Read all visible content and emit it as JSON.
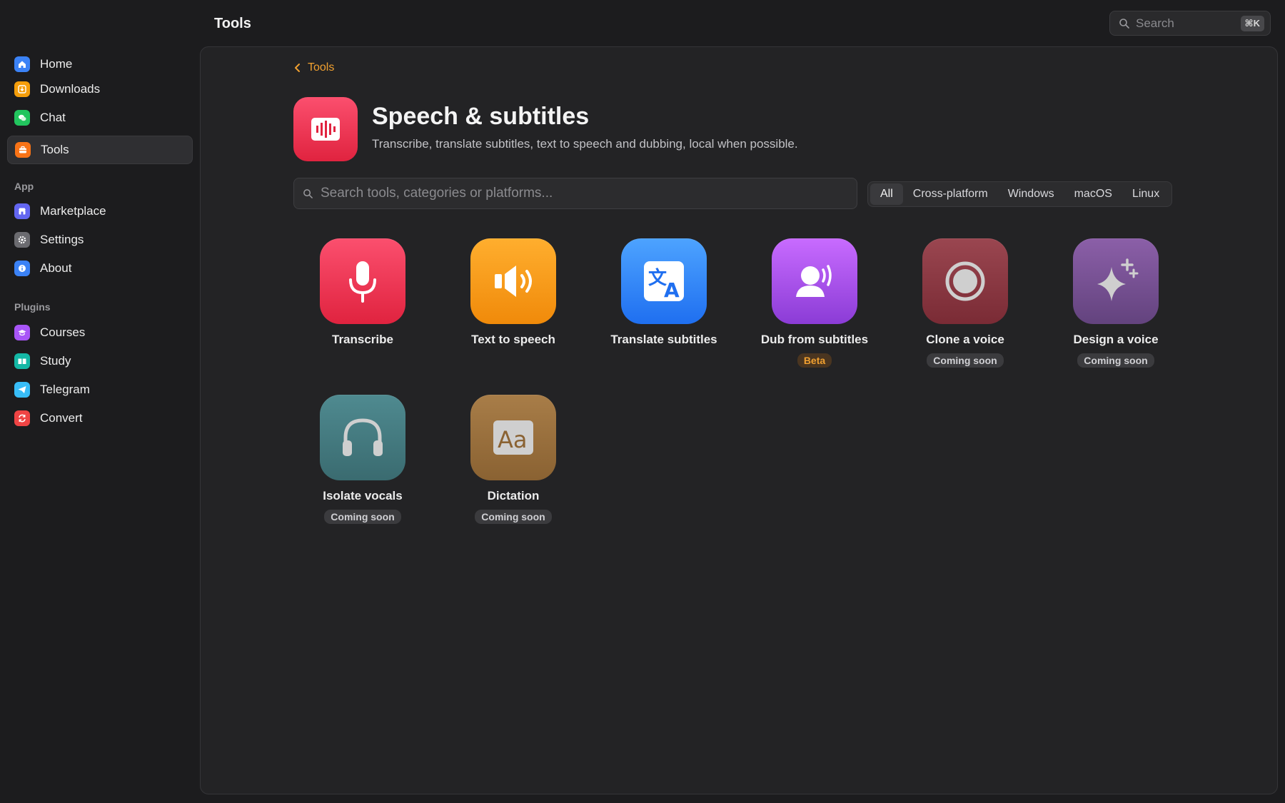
{
  "header": {
    "title": "Tools"
  },
  "top_search": {
    "placeholder": "Search",
    "shortcut": "⌘K"
  },
  "sidebar": {
    "items": [
      {
        "label": "Home",
        "icon": "home-icon",
        "color": "#3b82f6"
      },
      {
        "label": "Downloads",
        "icon": "download-icon",
        "color": "#f59e0b"
      },
      {
        "label": "Chat",
        "icon": "chat-icon",
        "color": "#22c55e"
      },
      {
        "label": "Tools",
        "icon": "toolbox-icon",
        "color": "#f97316",
        "active": true
      }
    ],
    "app_section": "App",
    "app_items": [
      {
        "label": "Marketplace",
        "icon": "store-icon",
        "color": "#6366f1"
      },
      {
        "label": "Settings",
        "icon": "gear-icon",
        "color": "#6b6b70"
      },
      {
        "label": "About",
        "icon": "info-icon",
        "color": "#3b82f6"
      }
    ],
    "plugins_section": "Plugins",
    "plugin_items": [
      {
        "label": "Courses",
        "icon": "graduation-cap-icon",
        "color": "#a855f7"
      },
      {
        "label": "Study",
        "icon": "book-icon",
        "color": "#14b8a6"
      },
      {
        "label": "Telegram",
        "icon": "paper-plane-icon",
        "color": "#38bdf8"
      },
      {
        "label": "Convert",
        "icon": "refresh-icon",
        "color": "#ef4444"
      }
    ]
  },
  "main": {
    "breadcrumb": "Tools",
    "title": "Speech & subtitles",
    "subtitle": "Transcribe, translate subtitles, text to speech and dubbing, local when possible.",
    "search_placeholder": "Search tools, categories or platforms...",
    "filters": [
      "All",
      "Cross-platform",
      "Windows",
      "macOS",
      "Linux"
    ],
    "active_filter": "All",
    "accent": "#f0a030",
    "tools": [
      {
        "name": "Transcribe",
        "icon": "microphone-icon",
        "badge": ""
      },
      {
        "name": "Text to speech",
        "icon": "speaker-icon",
        "badge": ""
      },
      {
        "name": "Translate subtitles",
        "icon": "translate-icon",
        "badge": ""
      },
      {
        "name": "Dub from subtitles",
        "icon": "speaking-head-icon",
        "badge": "Beta"
      },
      {
        "name": "Clone a voice",
        "icon": "record-icon",
        "badge": "Coming soon"
      },
      {
        "name": "Design a voice",
        "icon": "sparkle-icon",
        "badge": "Coming soon"
      },
      {
        "name": "Isolate vocals",
        "icon": "headphones-icon",
        "badge": "Coming soon"
      },
      {
        "name": "Dictation",
        "icon": "text-aa-icon",
        "badge": "Coming soon"
      }
    ]
  }
}
